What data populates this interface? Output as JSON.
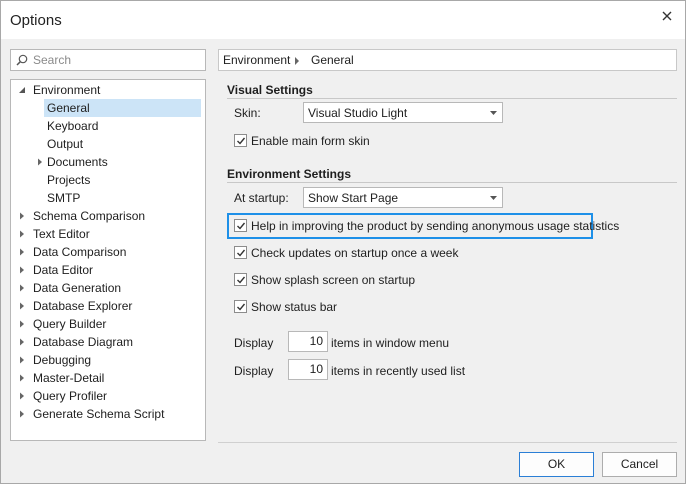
{
  "window": {
    "title": "Options",
    "close_icon": "close-icon"
  },
  "search": {
    "placeholder": "Search",
    "value": ""
  },
  "tree": [
    {
      "label": "Environment",
      "expanded": true,
      "level": 0
    },
    {
      "label": "General",
      "level": 1,
      "selected": true
    },
    {
      "label": "Keyboard",
      "level": 1
    },
    {
      "label": "Output",
      "level": 1
    },
    {
      "label": "Documents",
      "level": 1,
      "collapsed": true
    },
    {
      "label": "Projects",
      "level": 1
    },
    {
      "label": "SMTP",
      "level": 1
    },
    {
      "label": "Schema Comparison",
      "level": 0,
      "collapsed": true
    },
    {
      "label": "Text Editor",
      "level": 0,
      "collapsed": true
    },
    {
      "label": "Data Comparison",
      "level": 0,
      "collapsed": true
    },
    {
      "label": "Data Editor",
      "level": 0,
      "collapsed": true
    },
    {
      "label": "Data Generation",
      "level": 0,
      "collapsed": true
    },
    {
      "label": "Database Explorer",
      "level": 0,
      "collapsed": true
    },
    {
      "label": "Query Builder",
      "level": 0,
      "collapsed": true
    },
    {
      "label": "Database Diagram",
      "level": 0,
      "collapsed": true
    },
    {
      "label": "Debugging",
      "level": 0,
      "collapsed": true
    },
    {
      "label": "Master-Detail",
      "level": 0,
      "collapsed": true
    },
    {
      "label": "Query Profiler",
      "level": 0,
      "collapsed": true
    },
    {
      "label": "Generate Schema Script",
      "level": 0,
      "collapsed": true
    }
  ],
  "breadcrumb": {
    "root": "Environment",
    "current": "General"
  },
  "visual_settings": {
    "title": "Visual Settings",
    "skin_label": "Skin:",
    "skin_value": "Visual Studio Light",
    "enable_skin_label": "Enable main form skin",
    "enable_skin_checked": true
  },
  "environment_settings": {
    "title": "Environment Settings",
    "startup_label": "At startup:",
    "startup_value": "Show Start Page",
    "checks": [
      {
        "label": "Help in improving the product by sending anonymous usage statistics",
        "checked": true
      },
      {
        "label": "Check updates on startup once a week",
        "checked": true
      },
      {
        "label": "Show splash screen on startup",
        "checked": true
      },
      {
        "label": "Show status bar",
        "checked": true
      }
    ],
    "display_window": {
      "label": "Display",
      "value": "10",
      "suffix": "items in window menu"
    },
    "display_recent": {
      "label": "Display",
      "value": "10",
      "suffix": "items in recently used list"
    }
  },
  "buttons": {
    "ok": "OK",
    "cancel": "Cancel"
  },
  "colors": {
    "accent": "#1e90e8",
    "selection": "#cce4f7"
  }
}
